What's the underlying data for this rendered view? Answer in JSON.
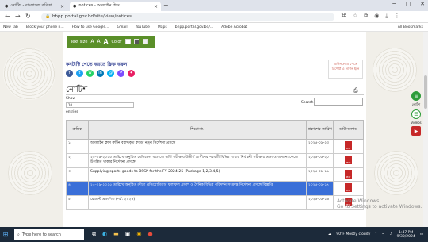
{
  "browser": {
    "tabs": [
      {
        "title": "নোটিশ - বাংলাদেশ কবিতা",
        "active": false
      },
      {
        "title": "notices - অনলাইন শিক্ষা",
        "active": true
      }
    ],
    "url": "bhpp.portal.gov.bd/site/view/notices",
    "bookmarks": [
      "New Tab",
      "Block your phone n...",
      "How to use Google...",
      "Gmail",
      "YouTube",
      "Maps",
      "bhpp.portal.gov.bd/...",
      "Adobe Acrobat"
    ],
    "all_bookmarks": "All Bookmarks"
  },
  "accessibility": {
    "text_size_label": "Text size",
    "a_minus": "A",
    "a_normal": "A",
    "a_plus": "A",
    "color_label": "Color"
  },
  "page": {
    "institution_link": "কনটাক্টি পেতে করতে ক্লিক করুন",
    "side_box": "ডাউনলোড পেতে রিপোর্ট এ লগিন ইনে",
    "title": "নোটিশ",
    "show_label": "Show",
    "show_value": "10",
    "entries_label": "entries",
    "search_label": "Search:"
  },
  "table": {
    "headers": [
      "ক্রমিক",
      "শিরোনাম",
      "প্রকাশের তারিখ",
      "ডাউনলোড"
    ],
    "rows": [
      {
        "num": "১",
        "title": "অনলাইন ক্লাস রুটিন বরাদ্দকৃত রুমের নতুন নির্দেশনা প্রসঙ্গে",
        "date": "২০২৫-০৯-২৩",
        "pdf": "PDF",
        "highlight": false
      },
      {
        "num": "২",
        "title": "২৫-০৯-২০২৫ তারিখে অনুষ্ঠিত মেডিকেল কলেজে ভর্তি পরীক্ষায় উত্তীর্ণ প্রার্থীদের পরবর্তী বিভিন্ন শাখার নির্বাচনী পরীক্ষার ঢাকা ও অন্যান্য কেন্দ্রে উপস্থিত থাকার নির্দেশনা প্রসঙ্গে",
        "date": "২০২৫-০৯-২০",
        "pdf": "PDF",
        "highlight": false
      },
      {
        "num": "৩",
        "title": "Supplying sports goods to BSSP for the FY 2024-25 (Package-1,2,3,4,5)",
        "date": "২০২৫-০৯-১৯",
        "pdf": "PDF",
        "highlight": false
      },
      {
        "num": "৪",
        "title": "২৫-০৯-২০২৫ তারিখে অনুষ্ঠিত ক্রীড়া প্রতিযোগিতার ফলাফল প্রকাশ ও দৈনিক বিভিন্ন পরিদর্শন সংক্রান্ত নির্দেশনা প্রসঙ্গে বিজ্ঞপ্তি",
        "date": "২০২৫-০৯-১৭",
        "pdf": "PDF",
        "highlight": true
      },
      {
        "num": "৫",
        "title": "রেজাল্ট প্রকাশিত (পর্ব: ২০২৫)",
        "date": "২০২৫-০৯-১৬",
        "pdf": "PDF",
        "highlight": false
      }
    ]
  },
  "right_sidebar": {
    "label1": "নোটিশ",
    "label2": "Videos"
  },
  "windows_watermark": {
    "line1": "Activate Windows",
    "line2": "Go to Settings to activate Windows."
  },
  "taskbar": {
    "search_placeholder": "Type here to search",
    "weather": "90°F  Mostly cloudy",
    "time": "1:47 PM",
    "date": "9/30/2024"
  }
}
